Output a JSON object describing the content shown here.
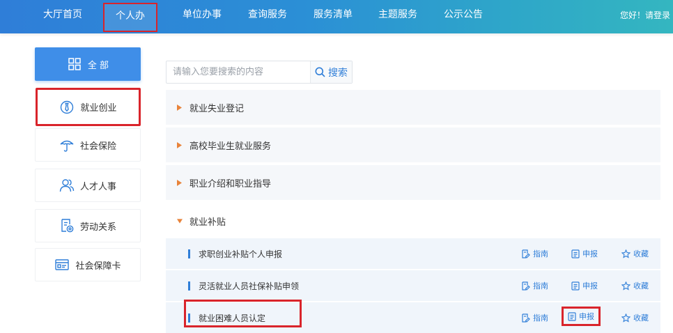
{
  "topnav": {
    "items": [
      {
        "label": "大厅首页",
        "active": false
      },
      {
        "label": "个人办",
        "active": true
      },
      {
        "label": "单位办事",
        "active": false
      },
      {
        "label": "查询服务",
        "active": false
      },
      {
        "label": "服务清单",
        "active": false
      },
      {
        "label": "主题服务",
        "active": false
      },
      {
        "label": "公示公告",
        "active": false
      }
    ],
    "greeting": "您好！请登录"
  },
  "sidebar": {
    "items": [
      {
        "label": "全 部",
        "icon": "grid-icon"
      },
      {
        "label": "就业创业",
        "icon": "tie-icon"
      },
      {
        "label": "社会保险",
        "icon": "umbrella-icon"
      },
      {
        "label": "人才人事",
        "icon": "users-icon"
      },
      {
        "label": "劳动关系",
        "icon": "document-gear-icon"
      },
      {
        "label": "社会保障卡",
        "icon": "card-icon"
      }
    ]
  },
  "search": {
    "placeholder": "请输入您要搜索的内容",
    "button_label": "搜索"
  },
  "categories": [
    {
      "label": "就业失业登记",
      "expanded": false
    },
    {
      "label": "高校毕业生就业服务",
      "expanded": false
    },
    {
      "label": "职业介绍和职业指导",
      "expanded": false
    },
    {
      "label": "就业补贴",
      "expanded": true
    }
  ],
  "services": [
    {
      "label": "求职创业补贴个人申报"
    },
    {
      "label": "灵活就业人员社保补贴申领"
    },
    {
      "label": "就业困难人员认定"
    }
  ],
  "actions": {
    "guide": "指南",
    "apply": "申报",
    "favorite": "收藏"
  },
  "colors": {
    "accent": "#2f7ed8",
    "highlight": "#d9242b",
    "arrow": "#e8833a"
  }
}
